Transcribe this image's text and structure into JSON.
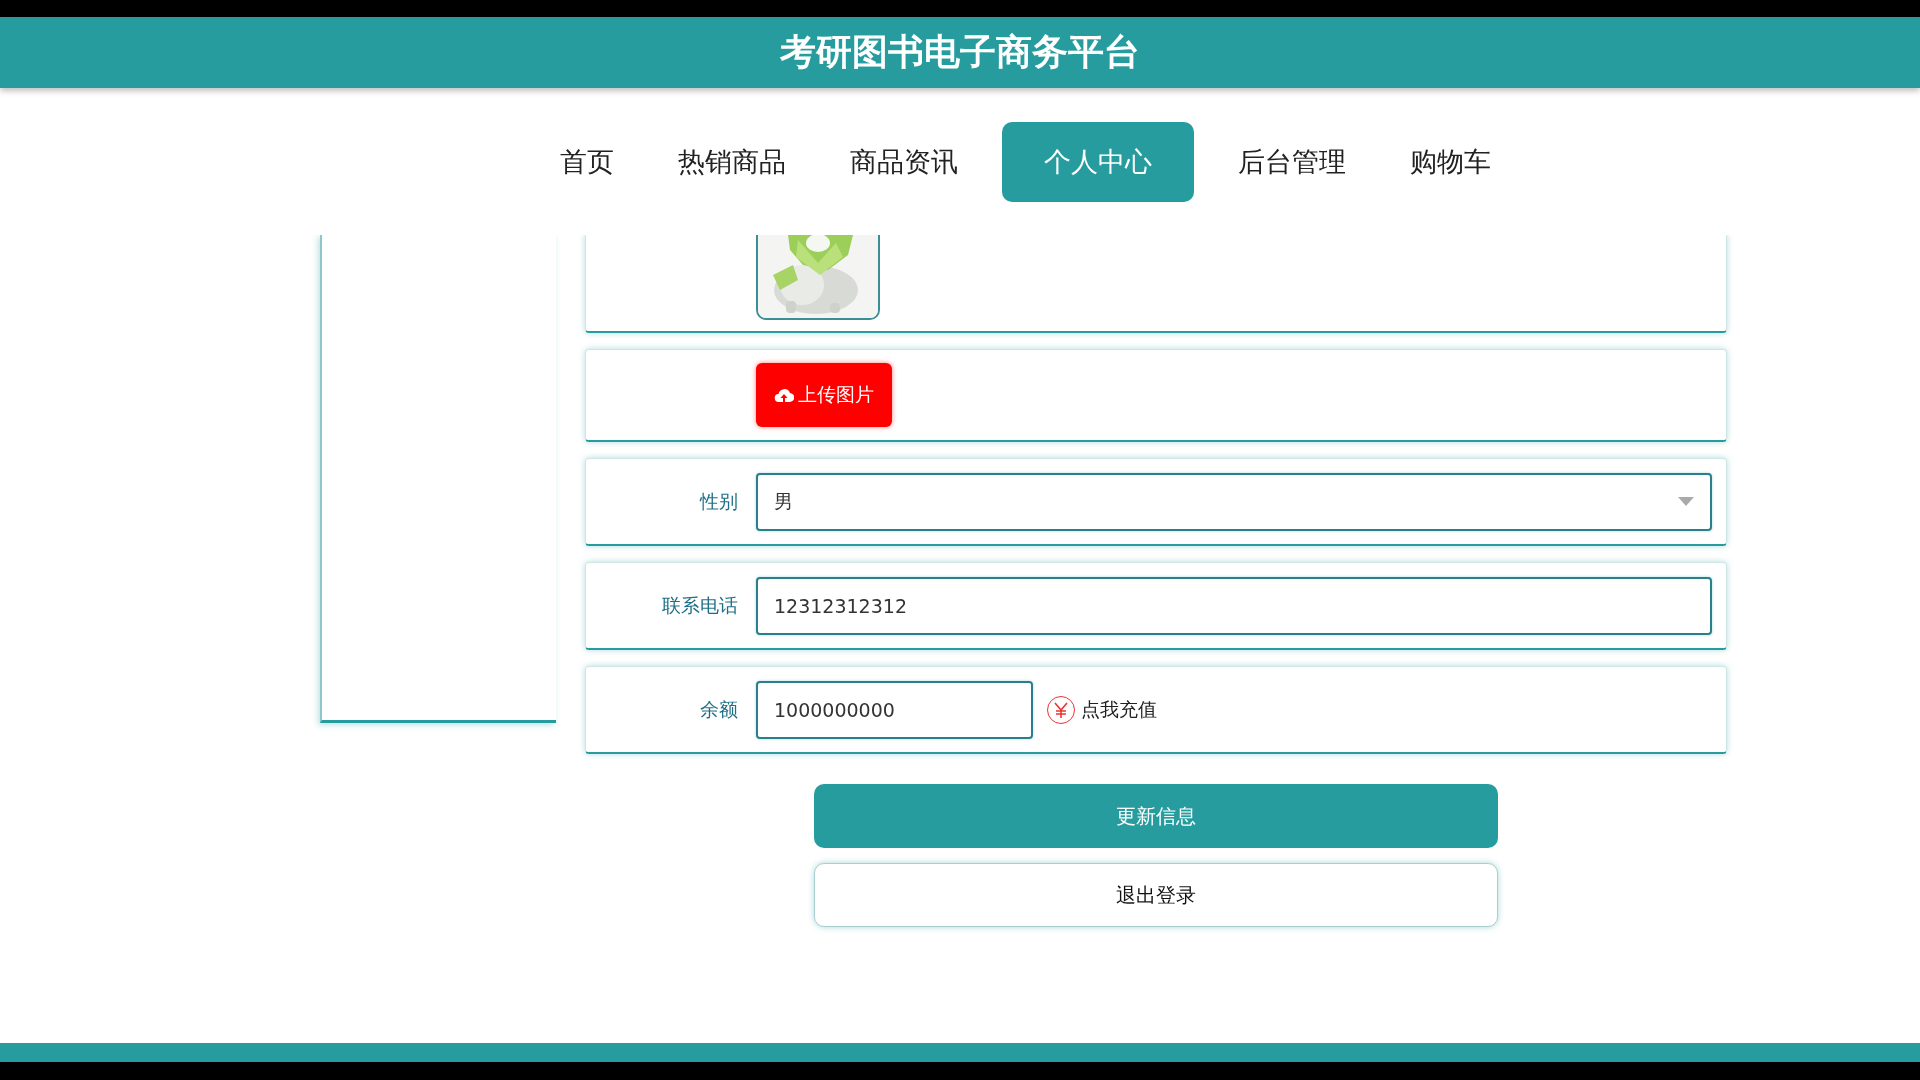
{
  "header": {
    "title": "考研图书电子商务平台"
  },
  "nav": [
    {
      "label": "首页",
      "selected": false
    },
    {
      "label": "热销商品",
      "selected": false
    },
    {
      "label": "商品资讯",
      "selected": false
    },
    {
      "label": "个人中心",
      "selected": true
    },
    {
      "label": "后台管理",
      "selected": false
    },
    {
      "label": "购物车",
      "selected": false
    }
  ],
  "form": {
    "upload_button": "上传图片",
    "fields": [
      {
        "kind": "select",
        "label": "性别",
        "value": "男"
      },
      {
        "kind": "text",
        "label": "联系电话",
        "value": "12312312312"
      },
      {
        "kind": "balance",
        "label": "余额",
        "value": "1000000000",
        "action": "点我充值"
      }
    ]
  },
  "buttons": [
    {
      "kind": "primary",
      "label": "更新信息"
    },
    {
      "kind": "secondary",
      "label": "退出登录"
    }
  ]
}
